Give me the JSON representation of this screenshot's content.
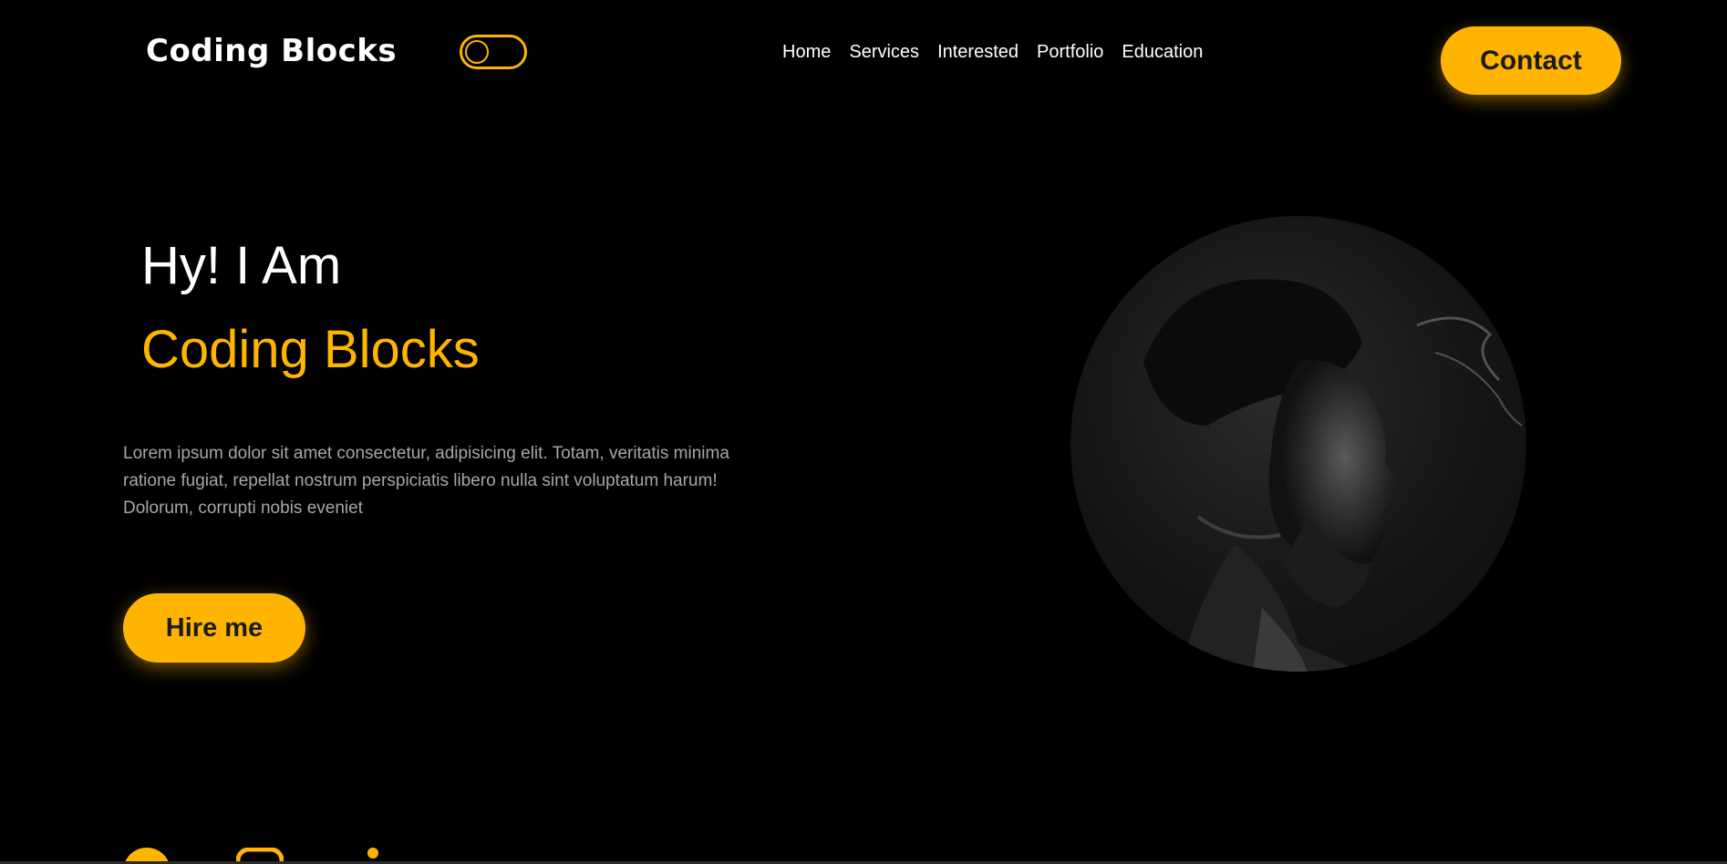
{
  "header": {
    "brand": "Coding Blocks",
    "nav": [
      "Home",
      "Services",
      "Interested",
      "Portfolio",
      "Education"
    ],
    "contact_label": "Contact"
  },
  "hero": {
    "greeting": "Hy! I Am",
    "name": "Coding Blocks",
    "description": "Lorem ipsum dolor sit amet consectetur, adipisicing elit. Totam, veritatis minima ratione fugiat, repellat nostrum perspiciatis libero nulla sint voluptatum harum! Dolorum, corrupti nobis eveniet",
    "hire_label": "Hire me"
  },
  "socials": [
    "github-icon",
    "instagram-icon",
    "linkedin-icon"
  ],
  "colors": {
    "background": "#000000",
    "accent": "#ffb400",
    "text": "#ffffff",
    "muted": "#a7a7a7"
  }
}
